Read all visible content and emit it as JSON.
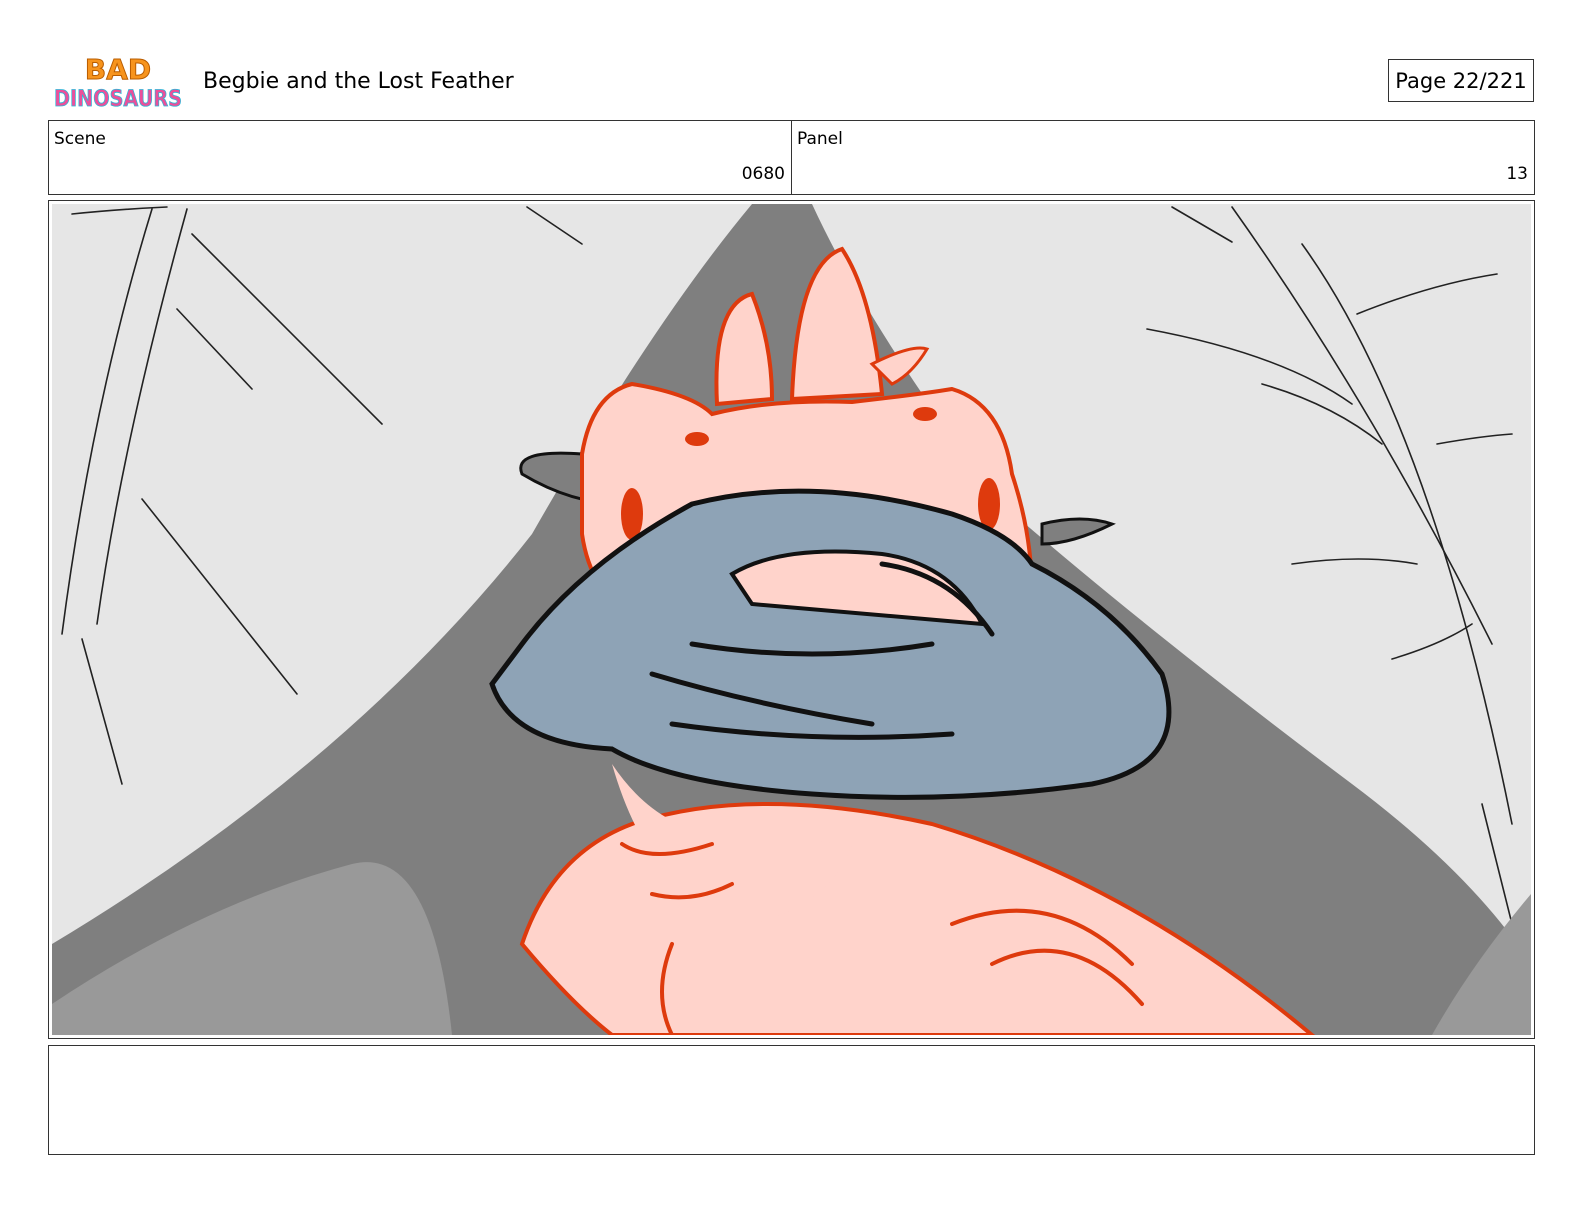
{
  "header": {
    "logo_line1": "BAD",
    "logo_line2": "DINOSAURS",
    "title": "Begbie and the Lost Feather",
    "page_label": "Page  22/221"
  },
  "info": {
    "scene_label": "Scene",
    "scene_value": "0680",
    "panel_label": "Panel",
    "panel_value": "13"
  },
  "panel": {
    "image": "storyboard-sketch",
    "colors": {
      "background": "#e6e6e6",
      "shadow": "#7f7f7f",
      "shadow_light": "#999999",
      "skin": "#ffd3cb",
      "skin_line": "#de3a0d",
      "hands": "#8ea3b6",
      "ink": "#111111"
    }
  },
  "caption": {
    "text": ""
  }
}
